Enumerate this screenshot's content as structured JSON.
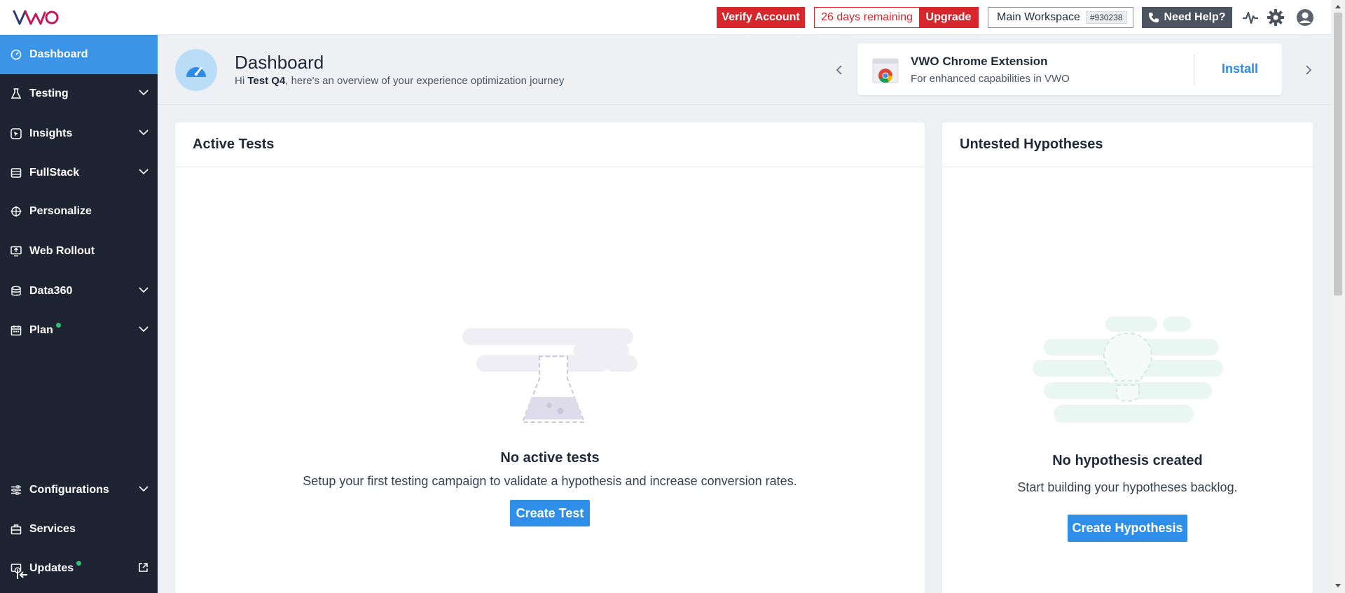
{
  "app": {
    "logo_text": "VWO"
  },
  "topbar": {
    "verify_label": "Verify Account",
    "trial_days": "26 days remaining",
    "upgrade_label": "Upgrade",
    "workspace_name": "Main Workspace",
    "workspace_id": "#930238",
    "help_label": "Need Help?",
    "icons": [
      "activity-icon",
      "gear-icon",
      "user-avatar-icon"
    ]
  },
  "sidebar": {
    "items": [
      {
        "label": "Dashboard",
        "icon": "speedometer-icon",
        "active": true,
        "chevron": false
      },
      {
        "label": "Testing",
        "icon": "flask-icon",
        "chevron": true
      },
      {
        "label": "Insights",
        "icon": "cursor-click-icon",
        "chevron": true
      },
      {
        "label": "FullStack",
        "icon": "server-icon",
        "chevron": true
      },
      {
        "label": "Personalize",
        "icon": "target-icon",
        "chevron": false
      },
      {
        "label": "Web Rollout",
        "icon": "monitor-upload-icon",
        "chevron": false
      },
      {
        "label": "Data360",
        "icon": "database-icon",
        "chevron": true
      },
      {
        "label": "Plan",
        "icon": "calendar-icon",
        "chevron": true,
        "dot": true
      }
    ],
    "bottom_items": [
      {
        "label": "Configurations",
        "icon": "sliders-icon",
        "chevron": true
      },
      {
        "label": "Services",
        "icon": "briefcase-icon"
      },
      {
        "label": "Updates",
        "icon": "updates-icon",
        "dot": true,
        "external": true
      }
    ],
    "collapse_icon": "collapse-left-icon"
  },
  "header": {
    "title": "Dashboard",
    "greeting_prefix": "Hi ",
    "user_name": "Test Q4",
    "greeting_suffix": ", here's an overview of your experience optimization journey"
  },
  "promo": {
    "title": "VWO Chrome Extension",
    "subtitle": "For enhanced capabilities in VWO",
    "cta": "Install"
  },
  "active_tests": {
    "heading": "Active Tests",
    "empty_title": "No active tests",
    "empty_desc": "Setup your first testing campaign to validate a hypothesis and increase conversion rates.",
    "cta": "Create Test"
  },
  "hypotheses": {
    "heading": "Untested Hypotheses",
    "empty_title": "No hypothesis created",
    "empty_desc": "Start building your hypotheses backlog.",
    "cta": "Create Hypothesis"
  },
  "colors": {
    "brand_red": "#d7262c",
    "brand_blue": "#3b94e6",
    "sidebar_bg": "#1f2433",
    "status_green": "#2fc27a"
  }
}
